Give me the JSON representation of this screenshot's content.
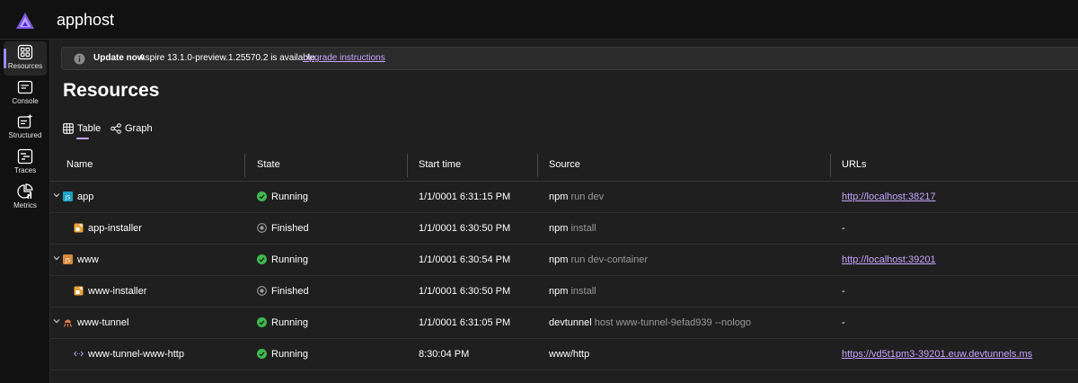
{
  "app": {
    "title": "apphost"
  },
  "colors": {
    "accent": "#c7a6ff",
    "running": "#3fb950",
    "finished": "#9a9a9a",
    "background": "#1f1f1f",
    "chrome": "#111111"
  },
  "sidebar": {
    "items": [
      {
        "label": "Resources",
        "icon": "resources-icon",
        "active": true
      },
      {
        "label": "Console",
        "icon": "console-icon"
      },
      {
        "label": "Structured",
        "icon": "structured-icon"
      },
      {
        "label": "Traces",
        "icon": "traces-icon"
      },
      {
        "label": "Metrics",
        "icon": "metrics-icon"
      }
    ]
  },
  "banner": {
    "icon": "info-icon",
    "bold": "Update now",
    "text": "Aspire 13.1.0-preview.1.25570.2 is available.",
    "link": "Upgrade instructions"
  },
  "page": {
    "title": "Resources"
  },
  "tabs": [
    {
      "label": "Table",
      "icon": "table-icon",
      "active": true
    },
    {
      "label": "Graph",
      "icon": "graph-icon"
    }
  ],
  "table": {
    "headers": {
      "name": "Name",
      "state": "State",
      "start_time": "Start time",
      "source": "Source",
      "urls": "URLs"
    },
    "rows": [
      {
        "name": "app",
        "icon": "javascript-icon",
        "expandable": true,
        "state": "Running",
        "start_time": "1/1/0001 6:31:15 PM",
        "source_cmd": "npm",
        "source_args": "run dev",
        "url": "http://localhost:38217",
        "url_is_link": true
      },
      {
        "name": "app-installer",
        "icon": "installer-icon",
        "child": true,
        "state": "Finished",
        "start_time": "1/1/0001 6:30:50 PM",
        "source_cmd": "npm",
        "source_args": "install",
        "url": "-",
        "url_is_link": false
      },
      {
        "name": "www",
        "icon": "javascript-icon",
        "expandable": true,
        "state": "Running",
        "start_time": "1/1/0001 6:30:54 PM",
        "source_cmd": "npm",
        "source_args": "run dev-container",
        "url": "http://localhost:39201",
        "url_is_link": true
      },
      {
        "name": "www-installer",
        "icon": "installer-icon",
        "child": true,
        "state": "Finished",
        "start_time": "1/1/0001 6:30:50 PM",
        "source_cmd": "npm",
        "source_args": "install",
        "url": "-",
        "url_is_link": false
      },
      {
        "name": "www-tunnel",
        "icon": "tunnel-icon",
        "expandable": true,
        "state": "Running",
        "start_time": "1/1/0001 6:31:05 PM",
        "source_cmd": "devtunnel",
        "source_args": "host www-tunnel-9efad939 --nologo",
        "url": "-",
        "url_is_link": false
      },
      {
        "name": "www-tunnel-www-http",
        "icon": "endpoint-icon",
        "child": true,
        "state": "Running",
        "start_time": "8:30:04 PM",
        "source_cmd": "www/http",
        "source_args": "",
        "url": "https://vd5t1pm3-39201.euw.devtunnels.ms",
        "url_is_link": true
      }
    ]
  }
}
